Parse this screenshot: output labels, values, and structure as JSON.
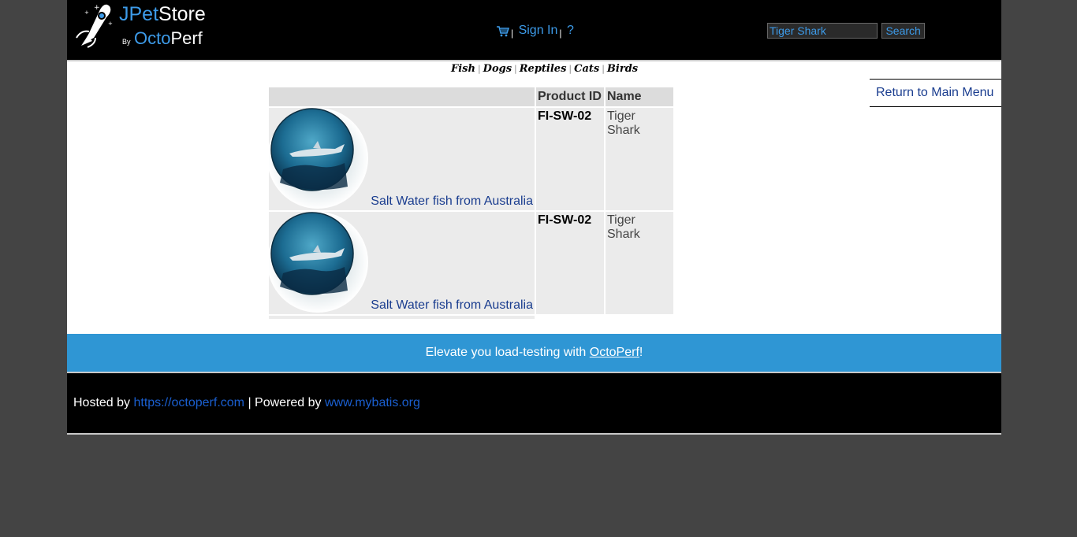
{
  "header": {
    "logo_text": "JPetStore",
    "logo_sub_by": "By",
    "logo_sub_brand": "OctoPerf",
    "cart_icon": "cart-icon",
    "sign_in_label": "Sign In",
    "help_label": "?",
    "separator": "|",
    "search": {
      "value": "Tiger Shark",
      "button_label": "Search"
    }
  },
  "quicklinks": {
    "fish": "Fish",
    "dogs": "Dogs",
    "reptiles": "Reptiles",
    "cats": "Cats",
    "birds": "Birds",
    "separator": "|"
  },
  "back_link": "Return to Main Menu",
  "table": {
    "headers": [
      "",
      "Product ID",
      "Name"
    ],
    "rows": [
      {
        "description": "Salt Water fish from Australia",
        "product_id": "FI-SW-02",
        "name": "Tiger Shark"
      },
      {
        "description": "Salt Water fish from Australia",
        "product_id": "FI-SW-02",
        "name": "Tiger Shark"
      }
    ]
  },
  "banner": {
    "prefix": "Elevate you load-testing with ",
    "link": "OctoPerf",
    "suffix": "!"
  },
  "footer": {
    "hosted_prefix": "Hosted by ",
    "hosted_link": "https://octoperf.com",
    "powered_prefix": " | Powered by ",
    "powered_link": "www.mybatis.org"
  },
  "colors": {
    "page_bg": "#444444",
    "header_bg": "#000000",
    "link_blue": "#3d9be9",
    "banner_blue": "#2f96d4",
    "row_bg": "#ebebeb",
    "header_cell_bg": "#dcdcdc"
  }
}
